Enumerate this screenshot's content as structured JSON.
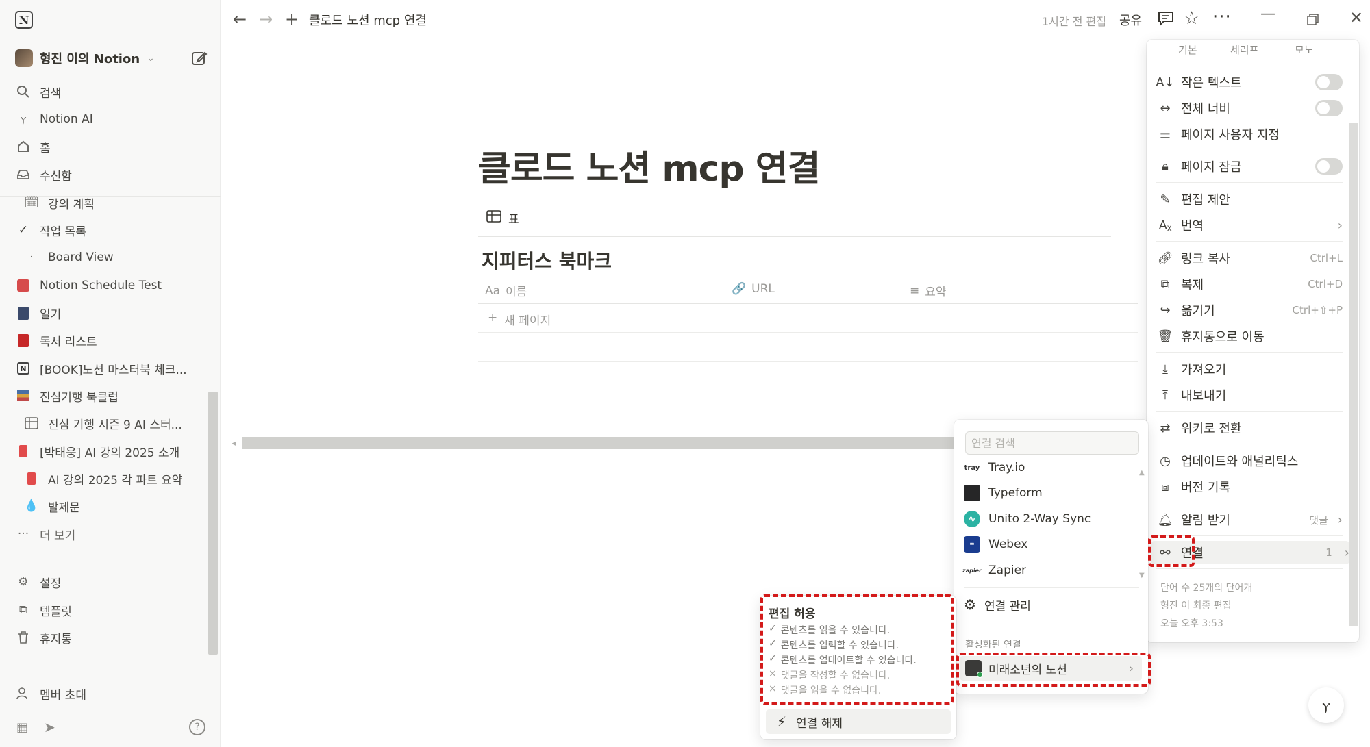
{
  "sidebar": {
    "workspace_name": "형진 이의 Notion",
    "nav": [
      {
        "label": "검색",
        "icon": "search-icon"
      },
      {
        "label": "Notion AI",
        "icon": "notion-ai-icon"
      },
      {
        "label": "홈",
        "icon": "home-icon"
      },
      {
        "label": "수신함",
        "icon": "inbox-icon"
      }
    ],
    "pages": [
      {
        "label": "강의 계획"
      },
      {
        "label": "작업 목록"
      },
      {
        "label": "Board View"
      },
      {
        "label": "Notion Schedule Test"
      },
      {
        "label": "일기"
      },
      {
        "label": "독서 리스트"
      },
      {
        "label": "[BOOK]노션 마스터북 체크..."
      },
      {
        "label": "진심기행 북클럽"
      },
      {
        "label": "진심 기행 시즌 9 AI 스터..."
      },
      {
        "label": "[박태웅] AI 강의 2025 소개"
      },
      {
        "label": "AI 강의 2025 각 파트 요약"
      },
      {
        "label": "발제문"
      },
      {
        "label": "더 보기"
      }
    ],
    "bottom": [
      {
        "label": "설정"
      },
      {
        "label": "템플릿"
      },
      {
        "label": "휴지통"
      },
      {
        "label": "멤버 초대"
      }
    ]
  },
  "topbar": {
    "breadcrumb": "클로드 노션 mcp 연결",
    "edited": "1시간 전 편집",
    "share": "공유"
  },
  "page": {
    "title": "클로드 노션 mcp 연결",
    "view_tab": "표",
    "db_title": "지피터스 북마크",
    "columns": [
      {
        "label": "이름",
        "prefix": "Aa"
      },
      {
        "label": "URL"
      },
      {
        "label": "요약"
      }
    ],
    "new_page": "새 페이지"
  },
  "page_menu": {
    "font_tabs": [
      "기본",
      "세리프",
      "모노"
    ],
    "items": [
      {
        "label": "작은 텍스트",
        "toggle": false
      },
      {
        "label": "전체 너비",
        "toggle": false
      },
      {
        "label": "페이지 사용자 지정"
      },
      {
        "label": "페이지 잠금",
        "toggle": false
      },
      {
        "label": "편집 제안"
      },
      {
        "label": "번역"
      },
      {
        "label": "링크 복사",
        "shortcut": "Ctrl+L"
      },
      {
        "label": "복제",
        "shortcut": "Ctrl+D"
      },
      {
        "label": "옮기기",
        "shortcut": "Ctrl+⇧+P"
      },
      {
        "label": "휴지통으로 이동"
      },
      {
        "label": "가져오기"
      },
      {
        "label": "내보내기"
      },
      {
        "label": "위키로 전환"
      },
      {
        "label": "업데이트와 애널리틱스"
      },
      {
        "label": "버전 기록"
      },
      {
        "label": "알림 받기",
        "value": "댓글"
      },
      {
        "label": "연결",
        "count": "1"
      }
    ],
    "info": [
      "단어 수 25개의 단어개",
      "형진 이 최종 편집",
      "오늘 오후 3:53"
    ]
  },
  "connections": {
    "search_placeholder": "연결 검색",
    "list": [
      {
        "name": "Tray.io",
        "color": "#ffffff"
      },
      {
        "name": "Typeform",
        "color": "#262627"
      },
      {
        "name": "Unito 2-Way Sync",
        "color": "#2bb3a3"
      },
      {
        "name": "Webex",
        "color": "#1a3c8f"
      },
      {
        "name": "Zapier",
        "color": "#ffffff"
      }
    ],
    "manage": "연결 관리",
    "active_label": "활성화된 연결",
    "active_item": "미래소년의 노션"
  },
  "permissions": {
    "title": "편집 허용",
    "lines": [
      {
        "mark": "✓",
        "text": "콘텐츠를 읽을 수 있습니다."
      },
      {
        "mark": "✓",
        "text": "콘텐츠를 입력할 수 있습니다."
      },
      {
        "mark": "✓",
        "text": "콘텐츠를 업데이트할 수 있습니다."
      },
      {
        "mark": "×",
        "text": "댓글을 작성할 수 없습니다."
      },
      {
        "mark": "×",
        "text": "댓글을 읽을 수 없습니다."
      }
    ],
    "disconnect": "연결 해제"
  },
  "colors": {
    "highlight": "#d31a1a",
    "sidebar_bg": "#f8f8f7",
    "text": "#37352f"
  }
}
